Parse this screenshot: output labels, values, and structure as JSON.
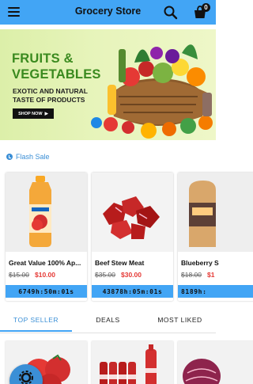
{
  "app_bar": {
    "title": "Grocery Store",
    "menu_icon": "menu-icon",
    "search_icon": "search-icon",
    "cart_icon": "cart-icon",
    "cart_count": "0",
    "color": "#42a5f5"
  },
  "banner": {
    "headline_line1": "FRUITS &",
    "headline_line2": "VEGETABLES",
    "subline1": "EXOTIC AND NATURAL",
    "subline2": "TASTE OF PRODUCTS",
    "cta_label": "SHOP NOW"
  },
  "flash_sale": {
    "label": "Flash Sale",
    "icon": "clock-icon",
    "products": [
      {
        "name": "Great Value 100% Ap...",
        "old_price": "$15.00",
        "new_price": "$10.00",
        "timer": "6749h:50m:01s"
      },
      {
        "name": "Beef Stew Meat",
        "old_price": "$35.00",
        "new_price": "$30.00",
        "timer": "43878h:05m:01s"
      },
      {
        "name": "Blueberry S",
        "old_price": "$18.00",
        "new_price": "$1",
        "timer": "8189h:"
      }
    ]
  },
  "tabs": [
    {
      "label": "TOP SELLER",
      "active": true
    },
    {
      "label": "DEALS",
      "active": false
    },
    {
      "label": "MOST LIKED",
      "active": false
    }
  ],
  "fab_icon": "settings-icon",
  "colors": {
    "primary": "#42a5f5",
    "sale_red": "#e53935",
    "banner_green": "#3a8a1f"
  }
}
